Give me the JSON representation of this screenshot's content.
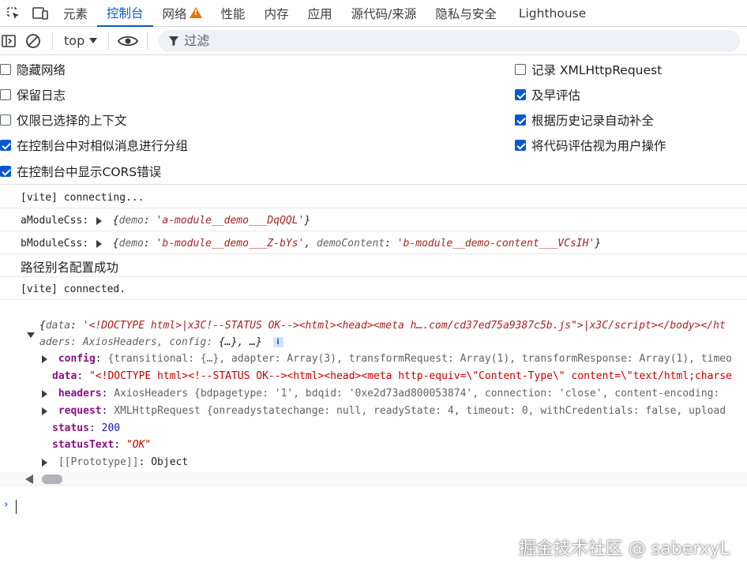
{
  "tabs": {
    "elements": "元素",
    "console": "控制台",
    "network": "网络",
    "performance": "性能",
    "memory": "内存",
    "application": "应用",
    "sources": "源代码/来源",
    "privacy": "隐私与安全",
    "lighthouse": "Lighthouse",
    "active": "控制台"
  },
  "toolbar": {
    "context": "top",
    "filter_placeholder": "过滤"
  },
  "settings": {
    "left": [
      {
        "label": "隐藏网络",
        "checked": false
      },
      {
        "label": "保留日志",
        "checked": false
      },
      {
        "label": "仅限已选择的上下文",
        "checked": false
      },
      {
        "label": "在控制台中对相似消息进行分组",
        "checked": true
      },
      {
        "label": "在控制台中显示CORS错误",
        "checked": true
      }
    ],
    "right": [
      {
        "label": "记录 XMLHttpRequest",
        "checked": false
      },
      {
        "label": "及早评估",
        "checked": true
      },
      {
        "label": "根据历史记录自动补全",
        "checked": true
      },
      {
        "label": "将代码评估视为用户操作",
        "checked": true
      }
    ]
  },
  "console": {
    "msg1": "[vite] connecting...",
    "msg2_label": "aModuleCss: ",
    "msg2_key": "demo",
    "msg2_val": "'a-module__demo___DqQQL'",
    "msg3_label": "bModuleCss: ",
    "msg3_key1": "demo",
    "msg3_val1": "'b-module__demo___Z-bYs'",
    "msg3_key2": "demoContent",
    "msg3_val2": "'b-module__demo-content___VCsIH'",
    "msg4": "路径别名配置成功",
    "msg5": "[vite] connected.",
    "resp_preview1_key": "data",
    "resp_preview1_val": "'<!DOCTYPE html>|x3C!--STATUS OK--><html><head><meta h….com/cd37ed75a9387c5b.js\">|x3C/script></body></ht",
    "resp_preview2": "aders: AxiosHeaders, config: {…},  …}",
    "resp_preview2_prefix": "aders: AxiosHeaders, config: ",
    "resp_preview2_ell": "{…}",
    "resp_preview2_tail": ",  …}",
    "info_badge": "i",
    "props": {
      "config_key": "config",
      "config_val": "{transitional: {…}, adapter: Array(3), transformRequest: Array(1), transformResponse: Array(1), timeo",
      "data_key": "data",
      "data_val": "\"<!DOCTYPE html><!--STATUS OK--><html><head><meta http-equiv=\\\"Content-Type\\\" content=\\\"text/html;charse",
      "headers_key": "headers",
      "headers_type": "AxiosHeaders",
      "headers_val": "{bdpagetype: '1', bdqid: '0xe2d73ad800053874', connection: 'close', content-encoding: ",
      "request_key": "request",
      "request_type": "XMLHttpRequest",
      "request_val": "{onreadystatechange: null, readyState: 4, timeout: 0, withCredentials: false, upload",
      "status_key": "status",
      "status_val": "200",
      "statusText_key": "statusText",
      "statusText_val": "\"OK\"",
      "proto_key": "[[Prototype]]",
      "proto_val": "Object"
    }
  },
  "watermark": "掘金技术社区 @ saberxyL"
}
